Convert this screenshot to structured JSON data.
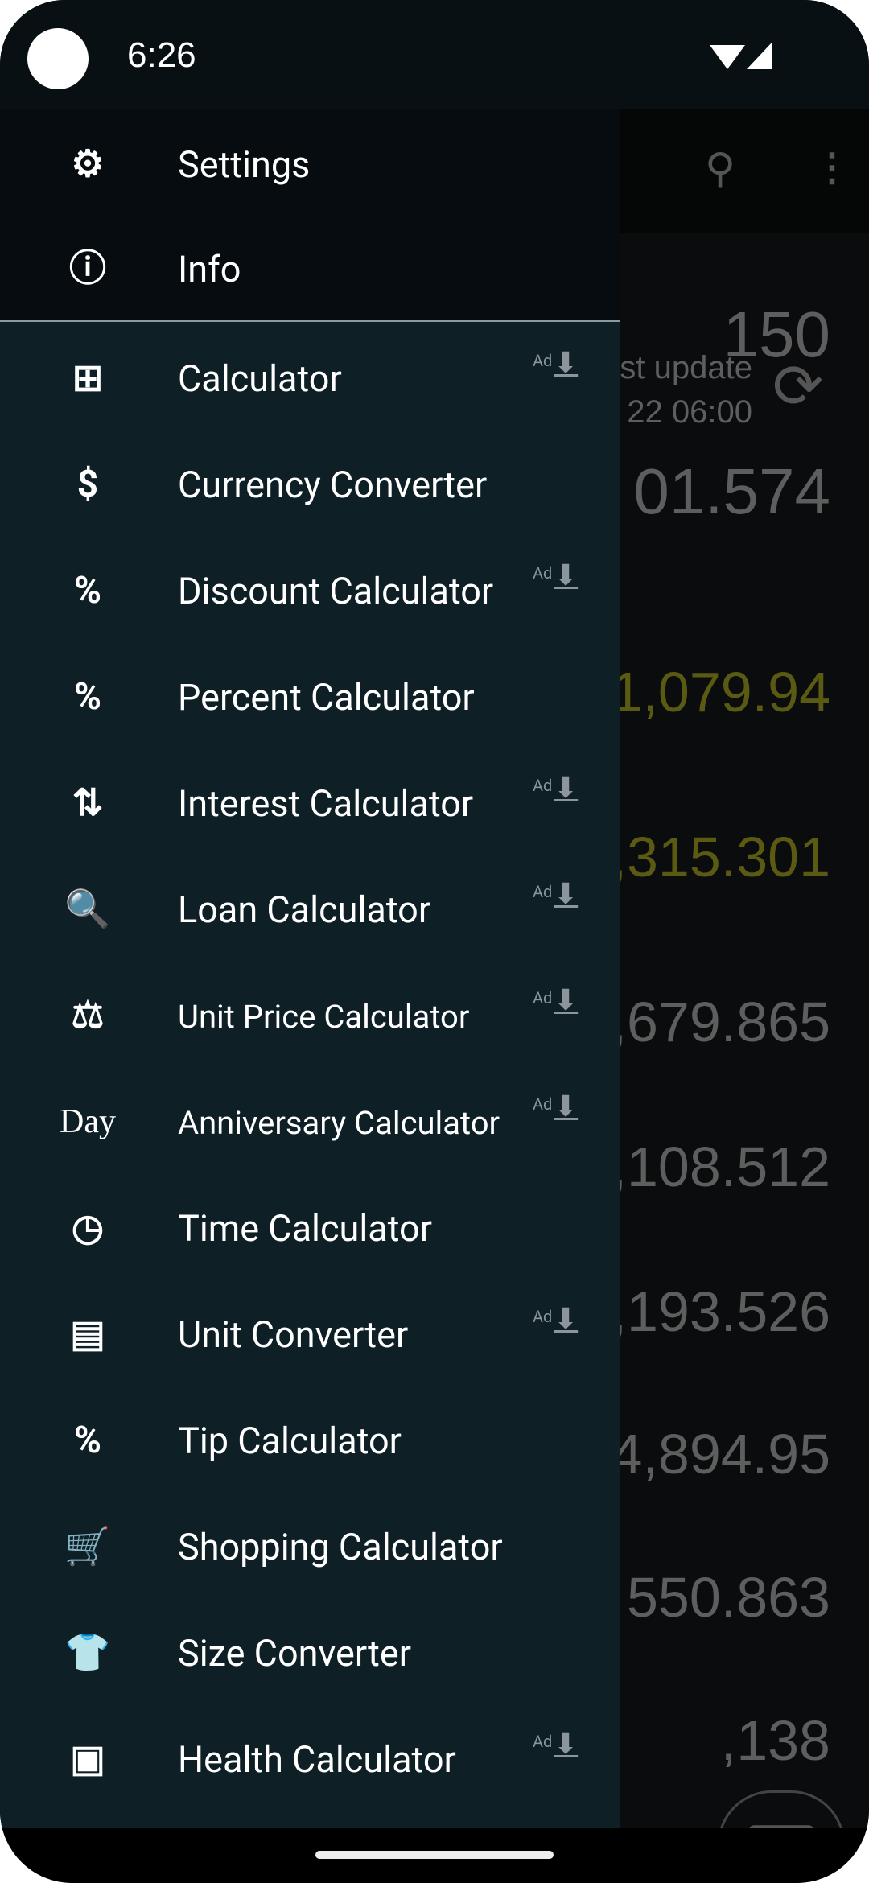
{
  "status": {
    "time": "6:26"
  },
  "background": {
    "values": [
      {
        "text": "150",
        "color": "gray"
      },
      {
        "text": "st update",
        "color": "gray"
      },
      {
        "text": "22 06:00",
        "color": "gray"
      },
      {
        "text": "01.574",
        "color": "gray"
      },
      {
        "text": "1,079.94",
        "color": "olive"
      },
      {
        "text": ",315.301",
        "color": "olive"
      },
      {
        "text": ",679.865",
        "color": "gray"
      },
      {
        "text": ",108.512",
        "color": "gray"
      },
      {
        "text": ",193.526",
        "color": "gray"
      },
      {
        "text": "4,894.95",
        "color": "gray"
      },
      {
        "text": "550.863",
        "color": "gray"
      },
      {
        "text": ",138",
        "color": "gray"
      }
    ]
  },
  "drawer": {
    "header_items": [
      {
        "label": "Settings",
        "icon": "gear-icon"
      },
      {
        "label": "Info",
        "icon": "info-icon"
      }
    ],
    "ad_label": "Ad",
    "items": [
      {
        "label": "Calculator",
        "icon": "calculator-icon",
        "ad": true
      },
      {
        "label": "Currency Converter",
        "icon": "dollar-icon",
        "ad": false
      },
      {
        "label": "Discount Calculator",
        "icon": "discount-bag-icon",
        "ad": true
      },
      {
        "label": "Percent Calculator",
        "icon": "percent-icon",
        "ad": false
      },
      {
        "label": "Interest Calculator",
        "icon": "interest-icon",
        "ad": true
      },
      {
        "label": "Loan Calculator",
        "icon": "loan-icon",
        "ad": true
      },
      {
        "label": "Unit Price Calculator",
        "icon": "scale-icon",
        "ad": true
      },
      {
        "label": "Anniversary Calculator",
        "icon": "day-icon",
        "icon_text": "Day",
        "ad": true
      },
      {
        "label": "Time Calculator",
        "icon": "clock-icon",
        "ad": false
      },
      {
        "label": "Unit Converter",
        "icon": "ruler-icon",
        "ad": true
      },
      {
        "label": "Tip Calculator",
        "icon": "tip-icon",
        "ad": false
      },
      {
        "label": "Shopping Calculator",
        "icon": "cart-icon",
        "ad": false
      },
      {
        "label": "Size Converter",
        "icon": "shirt-icon",
        "ad": false
      },
      {
        "label": "Health Calculator",
        "icon": "health-scale-icon",
        "ad": true
      }
    ]
  },
  "colors": {
    "drawer_bg": "#0e1f26",
    "header_bg": "#060c10",
    "olive": "#5b5a12",
    "gray": "#5e5e5e"
  }
}
